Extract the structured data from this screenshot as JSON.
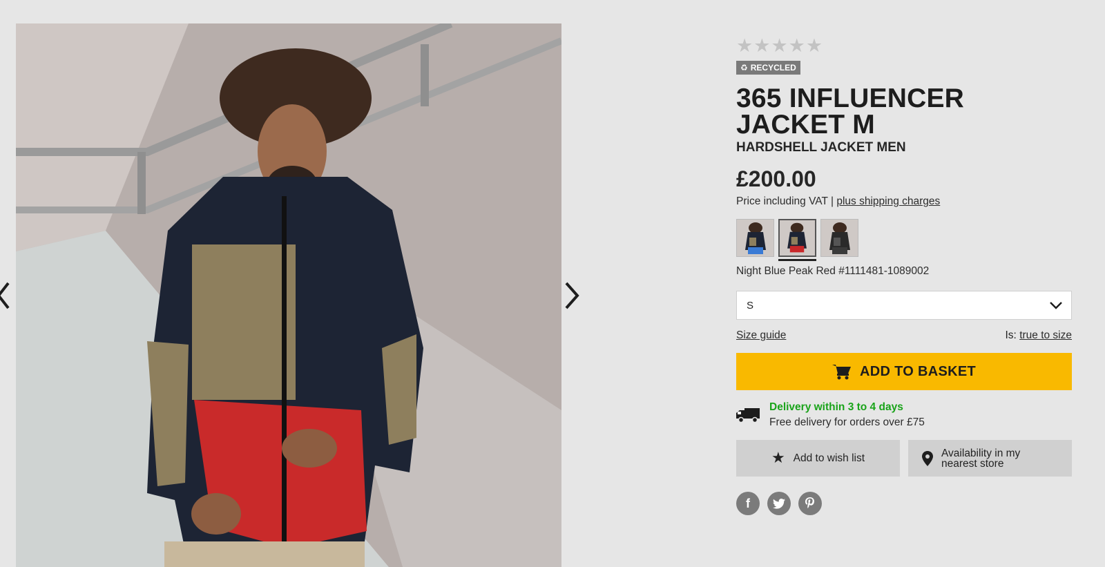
{
  "rating": {
    "stars": 5,
    "filled": 0
  },
  "badge": {
    "label": "RECYCLED",
    "icon": "recycle-icon"
  },
  "product": {
    "title": "365 INFLUENCER JACKET M",
    "subtitle": "HARDSHELL JACKET MEN",
    "price": "£200.00",
    "vat_text": "Price including VAT |",
    "shipping_link": "plus shipping charges",
    "color_label": "Night Blue Peak Red #1111481-1089002"
  },
  "swatches": [
    {
      "accent": "#3a7bd5",
      "selected": false
    },
    {
      "accent": "#c8282a",
      "selected": true
    },
    {
      "accent": "#3a3a3a",
      "selected": false
    }
  ],
  "size": {
    "selected": "S"
  },
  "size_guide": {
    "label": "Size guide",
    "fit_prefix": "Is:",
    "fit_value": "true to size"
  },
  "basket": {
    "label": "ADD TO BASKET"
  },
  "delivery": {
    "headline": "Delivery within 3 to 4 days",
    "sub": "Free delivery for orders over £75"
  },
  "actions": {
    "wishlist": "Add to wish list",
    "store": "Availability in my nearest store"
  },
  "colors": {
    "accent": "#f9b900",
    "delivery_green": "#19a319",
    "background": "#e6e6e6"
  }
}
